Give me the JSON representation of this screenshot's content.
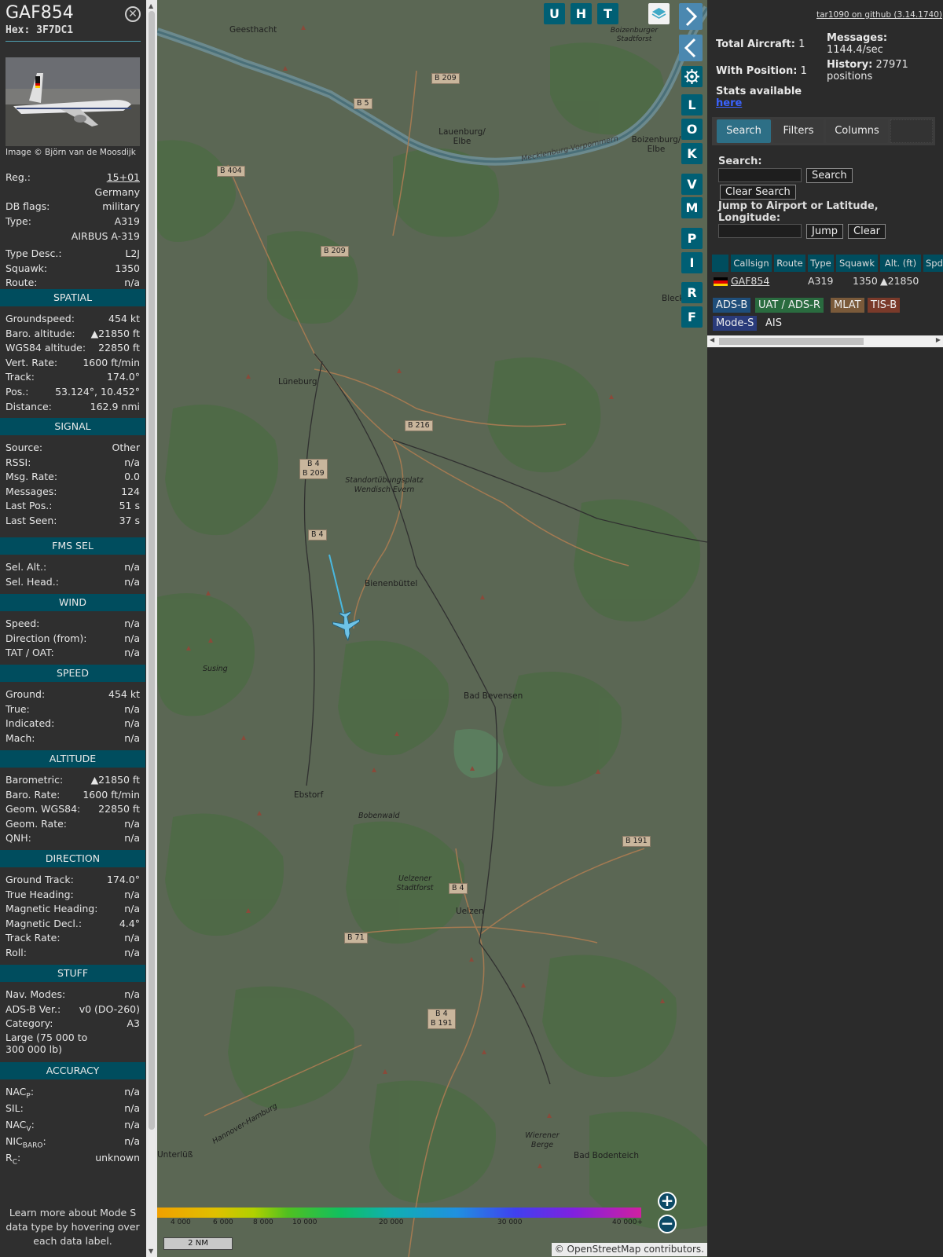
{
  "aircraft": {
    "callsign": "GAF854",
    "hex_label": "Hex:",
    "hex": "3F7DC1",
    "image_credit": "Image © Björn van de Moosdijk"
  },
  "info": [
    {
      "k": "Reg.:",
      "v": "15+01",
      "link": true
    },
    {
      "k": "",
      "v": "Germany"
    },
    {
      "k": "DB flags:",
      "v": "military"
    },
    {
      "k": "Type:",
      "v": "A319"
    },
    {
      "k": "",
      "v": "AIRBUS A-319"
    },
    {
      "k": "Type Desc.:",
      "v": "L2J"
    },
    {
      "k": "Squawk:",
      "v": "1350"
    },
    {
      "k": "Route:",
      "v": "n/a"
    }
  ],
  "sections": [
    {
      "title": "SPATIAL",
      "rows": [
        {
          "k": "Groundspeed:",
          "v": "454 kt"
        },
        {
          "k": "Baro. altitude:",
          "v": "▲21850 ft"
        },
        {
          "k": "WGS84 altitude:",
          "v": "22850 ft"
        },
        {
          "k": "Vert. Rate:",
          "v": "1600 ft/min"
        },
        {
          "k": "Track:",
          "v": "174.0°"
        },
        {
          "k": "Pos.:",
          "v": "53.124°, 10.452°"
        },
        {
          "k": "Distance:",
          "v": "162.9 nmi"
        }
      ]
    },
    {
      "title": "SIGNAL",
      "rows": [
        {
          "k": "Source:",
          "v": "Other"
        },
        {
          "k": "RSSI:",
          "v": "n/a"
        },
        {
          "k": "Msg. Rate:",
          "v": "0.0"
        },
        {
          "k": "Messages:",
          "v": "124"
        },
        {
          "k": "Last Pos.:",
          "v": "51 s"
        },
        {
          "k": "Last Seen:",
          "v": "37 s"
        }
      ]
    },
    {
      "title": "FMS SEL",
      "rows": [
        {
          "k": "Sel. Alt.:",
          "v": "n/a"
        },
        {
          "k": "Sel. Head.:",
          "v": "n/a"
        }
      ]
    },
    {
      "title": "WIND",
      "rows": [
        {
          "k": "Speed:",
          "v": "n/a"
        },
        {
          "k": "Direction (from):",
          "v": "n/a"
        },
        {
          "k": "TAT / OAT:",
          "v": "n/a"
        }
      ]
    },
    {
      "title": "SPEED",
      "rows": [
        {
          "k": "Ground:",
          "v": "454 kt"
        },
        {
          "k": "True:",
          "v": "n/a"
        },
        {
          "k": "Indicated:",
          "v": "n/a"
        },
        {
          "k": "Mach:",
          "v": "n/a"
        }
      ]
    },
    {
      "title": "ALTITUDE",
      "rows": [
        {
          "k": "Barometric:",
          "v": "▲21850 ft"
        },
        {
          "k": "Baro. Rate:",
          "v": "1600 ft/min"
        },
        {
          "k": "Geom. WGS84:",
          "v": "22850 ft"
        },
        {
          "k": "Geom. Rate:",
          "v": "n/a"
        },
        {
          "k": "QNH:",
          "v": "n/a"
        }
      ]
    },
    {
      "title": "DIRECTION",
      "rows": [
        {
          "k": "Ground Track:",
          "v": "174.0°"
        },
        {
          "k": "True Heading:",
          "v": "n/a"
        },
        {
          "k": "Magnetic Heading:",
          "v": "n/a"
        },
        {
          "k": "Magnetic Decl.:",
          "v": "4.4°"
        },
        {
          "k": "Track Rate:",
          "v": "n/a"
        },
        {
          "k": "Roll:",
          "v": "n/a"
        }
      ]
    },
    {
      "title": "STUFF",
      "rows": [
        {
          "k": "Nav. Modes:",
          "v": "n/a"
        },
        {
          "k": "ADS-B Ver.:",
          "v": "v0 (DO-260)"
        },
        {
          "k": "Category:",
          "v": "A3"
        },
        {
          "k": "Large (75 000 to 300 000 lb)",
          "v": ""
        }
      ]
    },
    {
      "title": "ACCURACY",
      "rows": [
        {
          "k": "NAC",
          "sub": "P",
          "v": "n/a"
        },
        {
          "k": "SIL:",
          "v": "n/a"
        },
        {
          "k": "NAC",
          "sub": "V",
          "v": "n/a"
        },
        {
          "k": "NIC",
          "sub": "BARO",
          "v": "n/a"
        },
        {
          "k": "R",
          "sub": "C",
          "v": "unknown"
        }
      ]
    }
  ],
  "note": "Learn more about Mode S data type by hovering over each data label.",
  "map": {
    "buttons_top": [
      "U",
      "H",
      "T"
    ],
    "buttons_side": [
      "L",
      "O",
      "K",
      "V",
      "M",
      "P",
      "I",
      "R",
      "F"
    ],
    "places": [
      {
        "name": "Geesthacht"
      },
      {
        "name": "Lauenburg/ Elbe"
      },
      {
        "name": "Mecklenburg-Vorpommern"
      },
      {
        "name": "Boizenburger Stadtforst"
      },
      {
        "name": "Boizenburg/ Elbe"
      },
      {
        "name": "Bleckede"
      },
      {
        "name": "Lüneburg"
      },
      {
        "name": "Standortübungsplatz Wendisch Evern"
      },
      {
        "name": "Bienenbüttel"
      },
      {
        "name": "Susing"
      },
      {
        "name": "Bad Bevensen"
      },
      {
        "name": "Ebstorf"
      },
      {
        "name": "Bobenwald"
      },
      {
        "name": "Uelzener Stadtforst"
      },
      {
        "name": "Uelzen"
      },
      {
        "name": "Hannover-Hamburg"
      },
      {
        "name": "Unterlüß"
      },
      {
        "name": "Wierener Berge"
      },
      {
        "name": "Bad Bodenteich"
      }
    ],
    "roads": [
      "B 209",
      "B 5",
      "B 404",
      "B 209",
      "B 216",
      "B 4 / B 209",
      "B 4",
      "B 191",
      "B 4",
      "B 71",
      "B 4 / B 191"
    ],
    "scale_ticks": [
      "4 000",
      "6 000",
      "8 000",
      "10 000",
      "20 000",
      "30 000",
      "40 000+"
    ],
    "scale_label": "2 NM",
    "attribution": "© OpenStreetMap contributors.",
    "zoom_in": "+",
    "zoom_out": "−"
  },
  "right": {
    "github": "tar1090 on github (3.14.1740)",
    "total_aircraft_label": "Total Aircraft:",
    "total_aircraft": "1",
    "with_position_label": "With Position:",
    "with_position": "1",
    "messages_label": "Messages:",
    "messages": "1144.4/sec",
    "history_label": "History:",
    "history": "27971 positions",
    "stats_label": "Stats available",
    "stats_link": "here",
    "tabs": [
      "Search",
      "Filters",
      "Columns"
    ],
    "search_label": "Search:",
    "search_btn": "Search",
    "clear_search_btn": "Clear Search",
    "jump_label": "Jump to Airport or Latitude, Longitude:",
    "jump_btn": "Jump",
    "clear_btn": "Clear",
    "columns": [
      "",
      "Callsign",
      "Route",
      "Type",
      "Squawk",
      "Alt. (ft)",
      "Spd"
    ],
    "row": {
      "callsign": "GAF854",
      "route": "",
      "type": "A319",
      "squawk": "1350",
      "alt": "▲21850"
    },
    "badges": [
      "ADS-B",
      "UAT / ADS-R",
      "MLAT",
      "TIS-B",
      "Mode-S",
      "AIS"
    ],
    "colors": {
      "adsb": "#1f4e7a",
      "uat": "#2a6b3f",
      "mlat": "#7a5a3a",
      "tisb": "#7a3a2a",
      "modes": "#2a3b7a"
    }
  }
}
